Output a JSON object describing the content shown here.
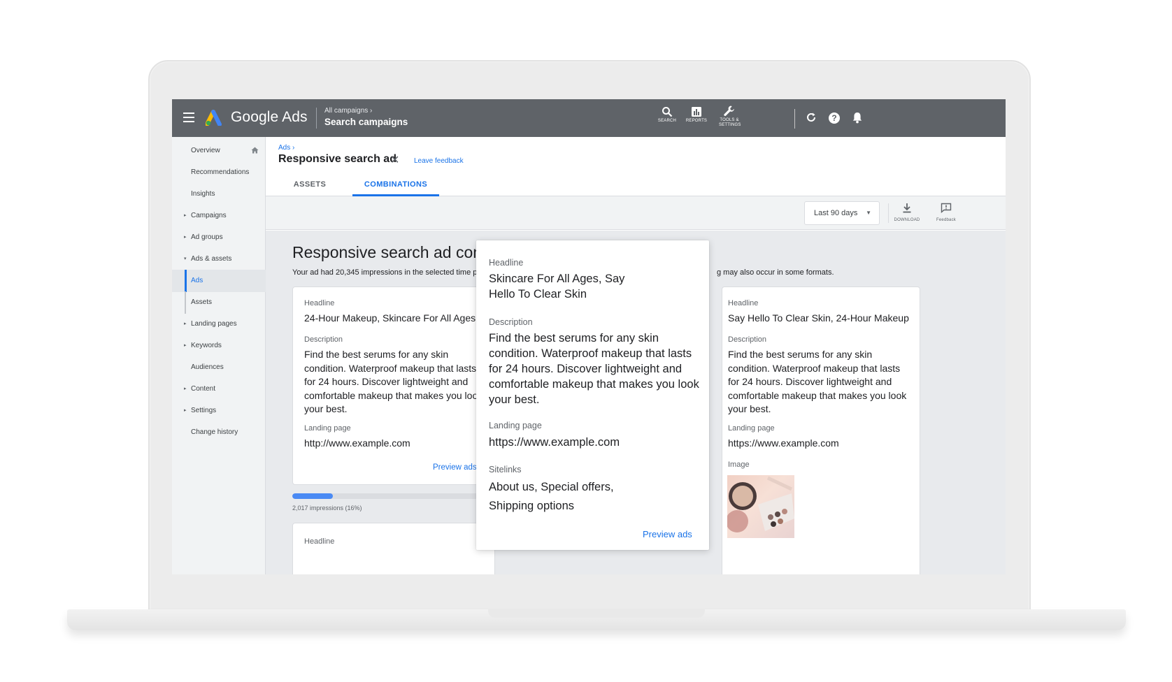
{
  "topbar": {
    "brand": "Google Ads",
    "crumb_parent": "All campaigns",
    "crumb_current": "Search campaigns",
    "tools": [
      {
        "label": "SEARCH",
        "icon": "search-icon"
      },
      {
        "label": "REPORTS",
        "icon": "reports-icon"
      },
      {
        "label": "TOOLS & SETTINGS",
        "icon": "wrench-icon"
      }
    ],
    "icons": [
      "refresh-icon",
      "help-icon",
      "notifications-icon"
    ]
  },
  "sidebar": {
    "items": [
      {
        "label": "Overview",
        "caret": ""
      },
      {
        "label": "Recommendations",
        "caret": ""
      },
      {
        "label": "Insights",
        "caret": ""
      },
      {
        "label": "Campaigns",
        "caret": "▸"
      },
      {
        "label": "Ad groups",
        "caret": "▸"
      },
      {
        "label": "Ads & assets",
        "caret": "▾"
      },
      {
        "label": "Ads",
        "caret": ""
      },
      {
        "label": "Assets",
        "caret": ""
      },
      {
        "label": "Landing pages",
        "caret": "▸"
      },
      {
        "label": "Keywords",
        "caret": "▸"
      },
      {
        "label": "Audiences",
        "caret": ""
      },
      {
        "label": "Content",
        "caret": "▸"
      },
      {
        "label": "Settings",
        "caret": "▸"
      },
      {
        "label": "Change history",
        "caret": ""
      }
    ],
    "active_item": "Ads"
  },
  "header": {
    "crumb": "Ads",
    "title": "Responsive search ad",
    "close_glyph": "✕",
    "feedback_link": "Leave feedback",
    "tabs": [
      {
        "label": "ASSETS",
        "selected": false
      },
      {
        "label": "COMBINATIONS",
        "selected": true
      }
    ]
  },
  "toolbar": {
    "date_range": "Last 90 days",
    "download_label": "DOWNLOAD",
    "feedback_label": "Feedback"
  },
  "main": {
    "title": "Responsive search ad combi",
    "subtitle_left": "Your ad had 20,345 impressions in the selected time pe",
    "subtitle_right": "g may also occur in some formats.",
    "card_left": {
      "headline_label": "Headline",
      "headline": "24-Hour Makeup, Skincare For All Ages",
      "description_label": "Description",
      "description": "Find the best serums for any skin condition. Waterproof makeup that lasts for 24 hours. Discover lightweight and comfortable makeup that makes you look your best.",
      "landing_label": "Landing page",
      "landing": "http://www.example.com",
      "preview": "Preview ads",
      "impressions_text": "2,017 impressions (16%)",
      "impressions_fraction": 0.2
    },
    "card_bottom": {
      "headline_label": "Headline"
    },
    "card_right": {
      "headline_label": "Headline",
      "headline": "Say Hello To Clear Skin, 24-Hour Makeup",
      "description_label": "Description",
      "description": "Find the best serums for any skin condition. Waterproof makeup that lasts for 24 hours. Discover lightweight and comfortable makeup that makes you look your best.",
      "landing_label": "Landing page",
      "landing": "https://www.example.com",
      "image_label": "Image"
    }
  },
  "popup": {
    "headline_label": "Headline",
    "headline": "Skincare For All Ages, Say Hello To Clear Skin",
    "description_label": "Description",
    "description": "Find the best serums for any skin condition. Waterproof makeup that lasts for 24 hours. Discover lightweight and comfortable makeup that makes you look your best.",
    "landing_label": "Landing page",
    "landing": "https://www.example.com",
    "sitelinks_label": "Sitelinks",
    "sitelinks": "About us, Special offers, Shipping options",
    "preview": "Preview ads"
  },
  "colors": {
    "topbar": "#5f6368",
    "accent": "#1a73e8",
    "sidebar": "#f1f3f4",
    "content_bg": "#e8eaed"
  }
}
